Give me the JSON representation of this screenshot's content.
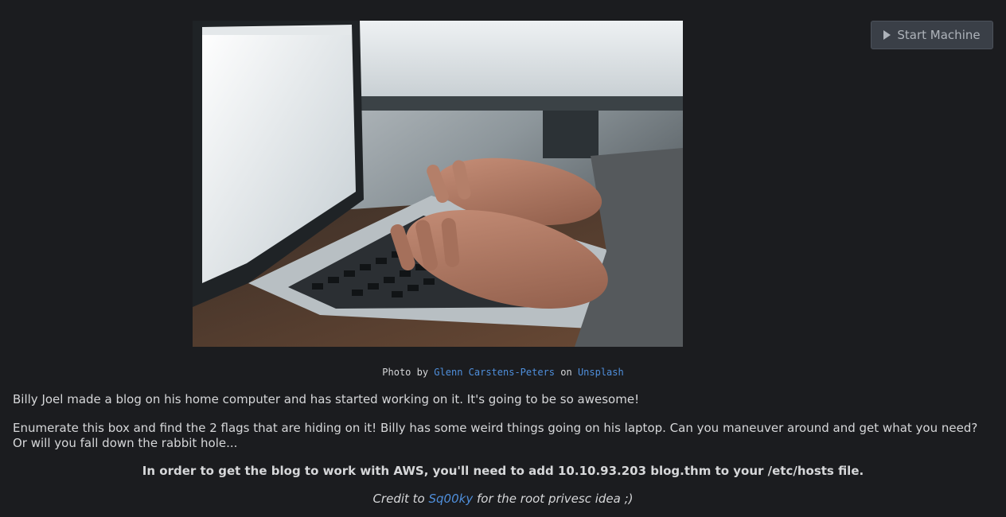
{
  "toolbar": {
    "start_label": "Start Machine",
    "start_icon": "play-icon"
  },
  "photo": {
    "alt": "Laptop keyboard with hands typing"
  },
  "caption": {
    "prefix": "Photo by",
    "author": "Glenn Carstens-Peters",
    "middle": "on",
    "site": "Unsplash"
  },
  "content": {
    "paragraph1": "Billy Joel made a blog on his home computer and has started working on it.  It's going to be so awesome!",
    "paragraph2": "Enumerate this box and find the 2 flags that are hiding on it!  Billy has some weird things going on his laptop.  Can you maneuver around and get what you need?  Or will you fall down the rabbit hole...",
    "hosts_notice": "In order to get the blog to work with AWS, you'll need to add 10.10.93.203 blog.thm to your /etc/hosts file."
  },
  "credit": {
    "prefix": "Credit to",
    "user": "Sq00ky",
    "suffix": "for the root privesc idea ;)"
  },
  "colors": {
    "background": "#1b1c1f",
    "text": "#d6d7d9",
    "link": "#4f8fdc",
    "button_bg": "#3a3f47"
  }
}
